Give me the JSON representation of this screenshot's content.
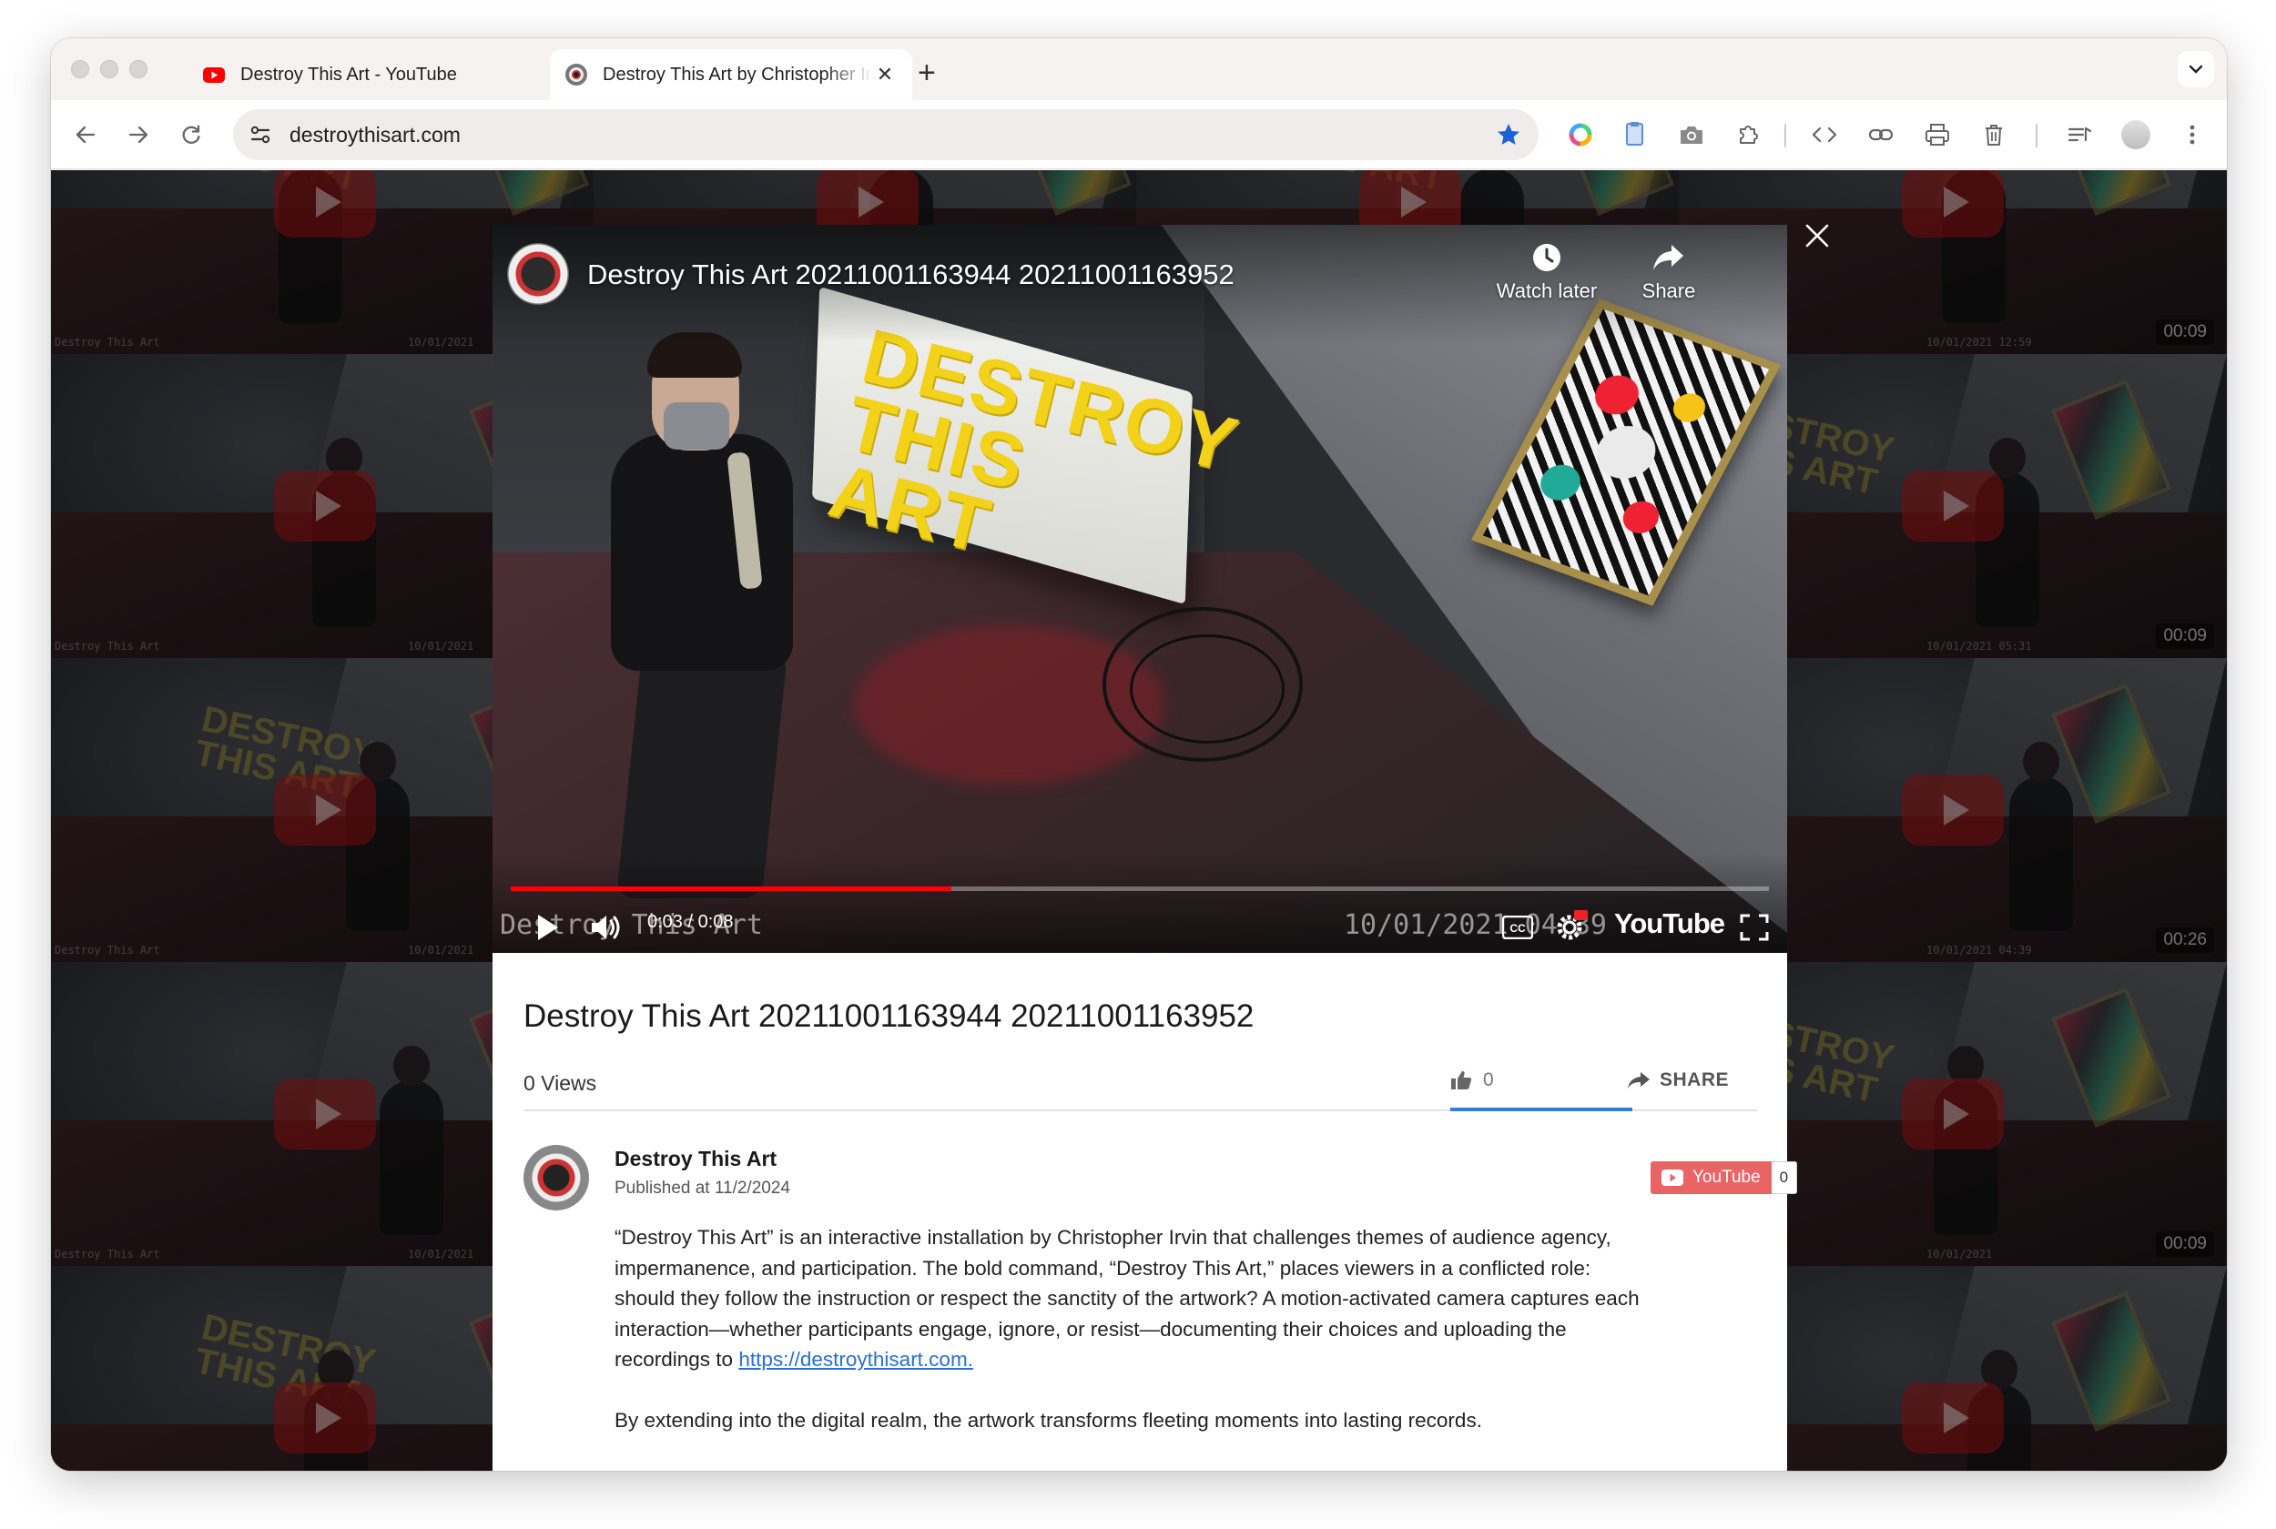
{
  "browser": {
    "tabs": [
      {
        "title": "Destroy This Art - YouTube",
        "close": "✕",
        "active": false
      },
      {
        "title": "Destroy This Art by Christopher Irvin",
        "close": "✕",
        "active": true
      }
    ],
    "new_tab": "+",
    "url": "destroythisart.com"
  },
  "background_tiles": {
    "caption_left": "Destroy This Art",
    "caption_date": "10/01/2021",
    "durations": [
      "00:09",
      "00:09",
      "00:26",
      "00:09"
    ],
    "right_dates": [
      "10/01/2021 12:59",
      "10/01/2021 05:31",
      "10/01/2021 04:39"
    ],
    "sign_text": "DESTROY THIS ART"
  },
  "player": {
    "title": "Destroy This Art 20211001163944 20211001163952",
    "watch_later": "Watch later",
    "share": "Share",
    "sign_text": "DESTROY THIS ART",
    "time": "0:03 / 0:08",
    "progress": 0.35,
    "burnin_left": "Destroy This Art",
    "burnin_right": "10/01/2021 04:39",
    "yt_logo": "YouTube",
    "hd": "HD"
  },
  "video_info": {
    "title": "Destroy This Art 20211001163944 20211001163952",
    "views": "0 Views",
    "likes": "0",
    "share": "SHARE",
    "channel": "Destroy This Art",
    "published": "Published at 11/2/2024",
    "subscribe_label": "YouTube",
    "subscriber_count": "0",
    "description_1": "“Destroy This Art” is an interactive installation by Christopher Irvin that challenges themes of audience agency, impermanence, and participation. The bold command, “Destroy This Art,” places viewers in a conflicted role: should they follow the instruction or respect the sanctity of the artwork? A motion-activated camera captures each interaction—whether participants engage, ignore, or resist—documenting their choices and uploading the recordings to",
    "description_link": "https://destroythisart.com.",
    "description_2": "By extending into the digital realm, the artwork transforms fleeting moments into lasting records."
  },
  "colors": {
    "accent_red": "#ff0000",
    "link": "#2a6fcf",
    "bookmark_star": "#1a63d6",
    "like_underline": "#3a7bd5"
  }
}
